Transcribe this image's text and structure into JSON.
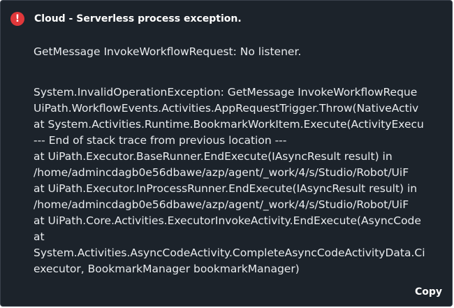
{
  "toast": {
    "title": "Cloud - Serverless process exception.",
    "icon": "error-circle-icon",
    "icon_glyph": "!",
    "icon_color": "#e0383b",
    "background_color": "#1c232b",
    "message": "GetMessage InvokeWorkflowRequest: No listener.",
    "stack_trace": [
      "System.InvalidOperationException: GetMessage InvokeWorkflowReque",
      "UiPath.WorkflowEvents.Activities.AppRequestTrigger.Throw(NativeActiv",
      "at System.Activities.Runtime.BookmarkWorkItem.Execute(ActivityExecu",
      "--- End of stack trace from previous location ---",
      "at UiPath.Executor.BaseRunner.EndExecute(IAsyncResult result) in",
      "/home/admincdagb0e56dbawe/azp/agent/_work/4/s/Studio/Robot/UiF",
      "at UiPath.Executor.InProcessRunner.EndExecute(IAsyncResult result) in",
      "/home/admincdagb0e56dbawe/azp/agent/_work/4/s/Studio/Robot/UiF",
      "at UiPath.Core.Activities.ExecutorInvokeActivity.EndExecute(AsyncCode",
      "at",
      "System.Activities.AsyncCodeActivity.CompleteAsyncCodeActivityData.Ci",
      "executor, BookmarkManager bookmarkManager)"
    ],
    "copy_label": "Copy"
  }
}
